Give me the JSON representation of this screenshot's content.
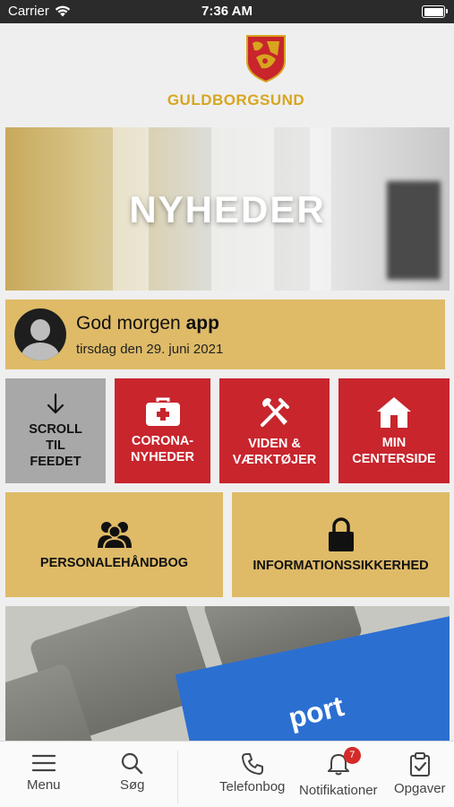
{
  "status_bar": {
    "carrier": "Carrier",
    "time": "7:36 AM"
  },
  "brand": {
    "name": "GULDBORGSUND",
    "accent": "#d7a51f",
    "crest_color": "#c8252d"
  },
  "banner": {
    "title": "NYHEDER"
  },
  "greeting": {
    "prefix": "God morgen",
    "user": "app",
    "date": "tirsdag den 29. juni 2021"
  },
  "tiles": {
    "scroll": {
      "line1": "SCROLL",
      "line2": "TIL",
      "line3": "FEEDET",
      "icon": "arrow-down-icon"
    },
    "corona": {
      "line1": "CORONA-",
      "line2": "NYHEDER",
      "icon": "first-aid-kit-icon"
    },
    "tools": {
      "line1": "VIDEN &",
      "line2": "VÆRKTØJER",
      "icon": "tools-icon"
    },
    "center": {
      "line1": "MIN",
      "line2": "CENTERSIDE",
      "icon": "home-icon"
    },
    "handbook": {
      "label": "PERSONALEHÅNDBOG",
      "icon": "people-icon"
    },
    "security": {
      "label": "INFORMATIONSSIKKERHED",
      "icon": "lock-icon"
    }
  },
  "promo": {
    "overlay_text": "port"
  },
  "tabbar": {
    "menu": "Menu",
    "search": "Søg",
    "phonebook": "Telefonbog",
    "notifications": "Notifikationer",
    "notifications_count": "7",
    "tasks": "Opgaver"
  },
  "colors": {
    "red": "#c8252d",
    "gold": "#dfbb68",
    "grey": "#a8a8a8"
  }
}
